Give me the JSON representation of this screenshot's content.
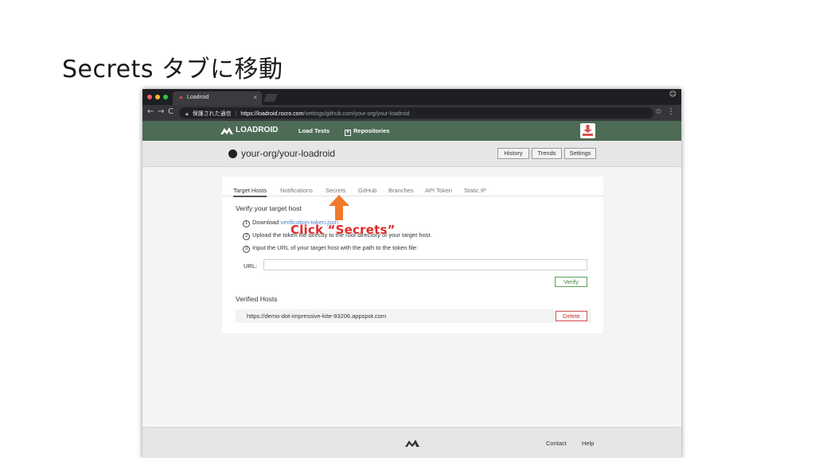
{
  "slide": {
    "title": "Secrets タブに移動"
  },
  "browser": {
    "tab_title": "Loadroid",
    "tab_close": "×",
    "secure_label": "保護された通信",
    "url_host": "https://loadroid.rocro.com",
    "url_path": "/settings/github.com/your-org/your-loadroid",
    "back_icon": "←",
    "forward_icon": "→",
    "reload_icon": "C",
    "star_icon": "☆",
    "menu_icon": "⋮"
  },
  "app_nav": {
    "brand": "LOADROID",
    "load_tests": "Load Tests",
    "repositories": "Repositories"
  },
  "repo": {
    "title": "your-org/your-loadroid",
    "buttons": {
      "history": "History",
      "trends": "Trends",
      "settings": "Settings"
    }
  },
  "settings_tabs": [
    "Target Hosts",
    "Notifications",
    "Secrets",
    "GitHub",
    "Branches",
    "API Token",
    "Static IP"
  ],
  "verify": {
    "title": "Verify your target host",
    "steps": [
      {
        "num": "1",
        "text": "Download ",
        "link": "verification-token.json"
      },
      {
        "num": "2",
        "text": "Upload the token file directly to the root directory of your target host."
      },
      {
        "num": "3",
        "text": "Input the URL of your target host with the path to the token file:"
      }
    ],
    "url_label": "URL:",
    "url_value": "",
    "verify_button": "Verify"
  },
  "verified_hosts": {
    "title": "Verified Hosts",
    "hosts": [
      {
        "url": "https://demo-dot-impressive-kite-93206.appspot.com",
        "delete_label": "Delete"
      }
    ]
  },
  "footer": {
    "contact": "Contact",
    "help": "Help"
  },
  "callout": {
    "text": "Click “Secrets”",
    "color": "#e02a2a",
    "arrow_color": "#f07a2a"
  },
  "colors": {
    "app_nav_bg": "#4d6b55",
    "browser_chrome": "#35363a"
  }
}
